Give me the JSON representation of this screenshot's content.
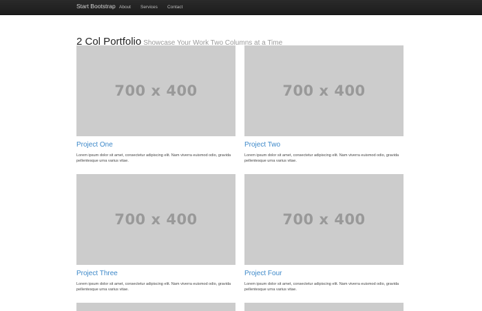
{
  "navbar": {
    "brand": "Start Bootstrap",
    "links": [
      "About",
      "Services",
      "Contact"
    ]
  },
  "header": {
    "title": "2 Col Portfolio",
    "subtitle": "Showcase Your Work Two Columns at a Time"
  },
  "projects": [
    {
      "placeholder": "700 x 400",
      "title": "Project One",
      "description": "Lorem ipsum dolor sit amet, consectetur adipiscing elit. Nam viverra euismod odio, gravida pellentesque urna varius vitae."
    },
    {
      "placeholder": "700 x 400",
      "title": "Project Two",
      "description": "Lorem ipsum dolor sit amet, consectetur adipiscing elit. Nam viverra euismod odio, gravida pellentesque urna varius vitae."
    },
    {
      "placeholder": "700 x 400",
      "title": "Project Three",
      "description": "Lorem ipsum dolor sit amet, consectetur adipiscing elit. Nam viverra euismod odio, gravida pellentesque urna varius vitae."
    },
    {
      "placeholder": "700 x 400",
      "title": "Project Four",
      "description": "Lorem ipsum dolor sit amet, consectetur adipiscing elit. Nam viverra euismod odio, gravida pellentesque urna varius vitae."
    }
  ],
  "colors": {
    "navbar": "#222222",
    "placeholder": "#cccccc",
    "placeholder_text": "#999999",
    "link": "#3b87c8"
  }
}
